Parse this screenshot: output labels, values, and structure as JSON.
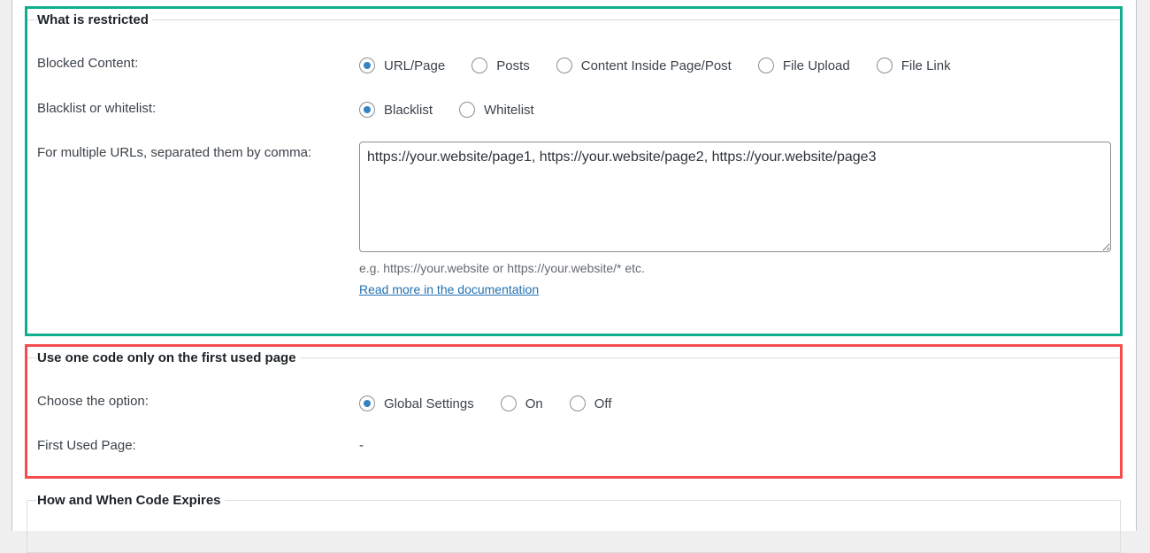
{
  "sections": [
    {
      "title": "What is restricted",
      "highlight_color": "#0fae8e",
      "rows": [
        {
          "label": "Blocked Content:",
          "options": [
            {
              "label": "URL/Page",
              "checked": true
            },
            {
              "label": "Posts",
              "checked": false
            },
            {
              "label": "Content Inside Page/Post",
              "checked": false
            },
            {
              "label": "File Upload",
              "checked": false
            },
            {
              "label": "File Link",
              "checked": false
            }
          ]
        },
        {
          "label": "Blacklist or whitelist:",
          "options": [
            {
              "label": "Blacklist",
              "checked": true
            },
            {
              "label": "Whitelist",
              "checked": false
            }
          ]
        },
        {
          "label": "For multiple URLs, separated them by comma:",
          "textarea_value": "https://your.website/page1, https://your.website/page2, https://your.website/page3",
          "hint": "e.g. https://your.website or https://your.website/* etc.",
          "link": "Read more in the documentation"
        }
      ]
    },
    {
      "title": "Use one code only on the first used page",
      "highlight_color": "#f44c4c",
      "rows": [
        {
          "label": "Choose the option:",
          "options": [
            {
              "label": "Global Settings",
              "checked": true
            },
            {
              "label": "On",
              "checked": false
            },
            {
              "label": "Off",
              "checked": false
            }
          ]
        },
        {
          "label": "First Used Page:",
          "value": "-"
        }
      ]
    },
    {
      "title": "How and When Code Expires"
    }
  ]
}
